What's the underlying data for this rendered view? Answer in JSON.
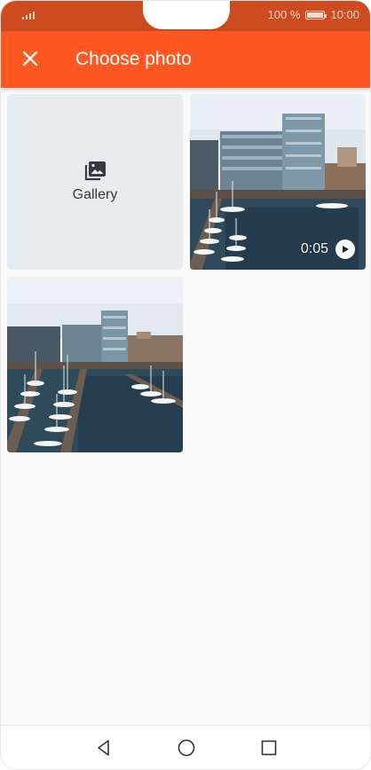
{
  "status_bar": {
    "battery_text": "100 %",
    "time": "10:00"
  },
  "app_bar": {
    "title": "Choose photo",
    "close_icon": "close-icon"
  },
  "grid": {
    "gallery_tile": {
      "label": "Gallery",
      "icon": "gallery-icon"
    },
    "media": [
      {
        "type": "video",
        "duration": "0:05",
        "icon": "play-icon"
      },
      {
        "type": "photo"
      }
    ]
  },
  "nav_bar": {
    "buttons": [
      "back-icon",
      "home-icon",
      "recents-icon"
    ]
  },
  "colors": {
    "status_bar": "#ce4a1f",
    "app_bar": "#ff5722",
    "gallery_tile_bg": "#e9ecef"
  }
}
